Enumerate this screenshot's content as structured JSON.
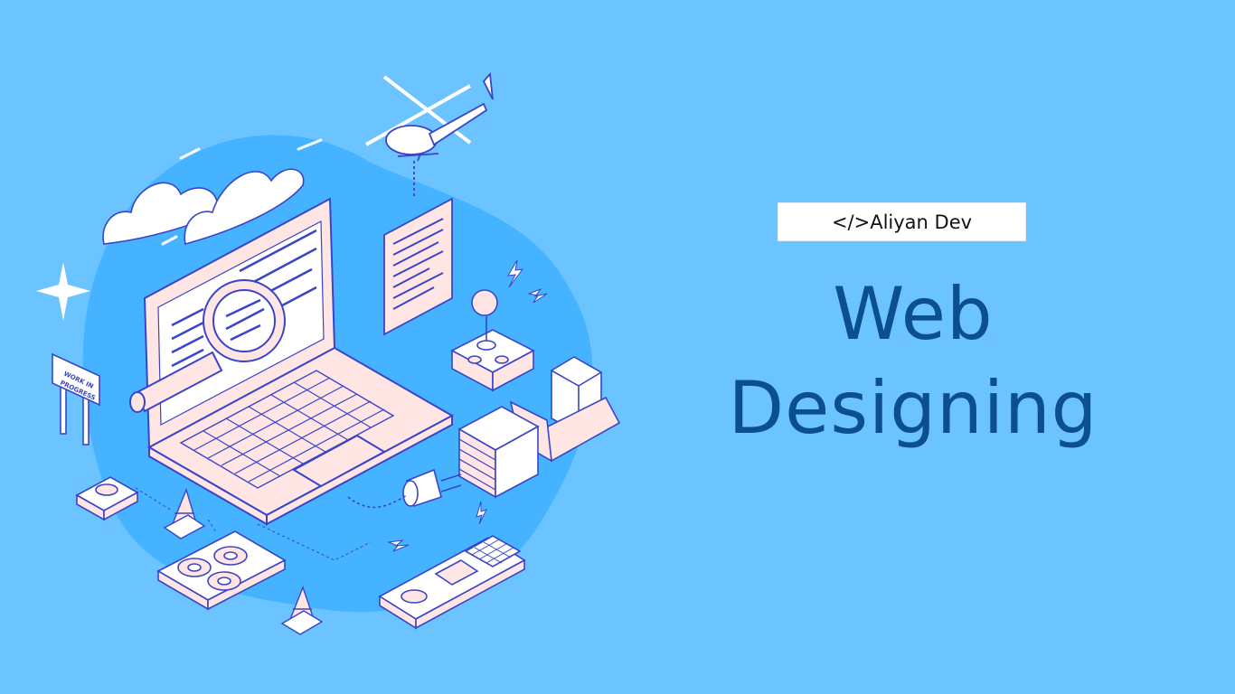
{
  "brand": {
    "label": "</>Aliyan Dev"
  },
  "headline": {
    "line1": "Web",
    "line2": "Designing"
  },
  "sign": {
    "line1": "WORK IN",
    "line2": "PROGRESS"
  },
  "colors": {
    "background": "#6bc4ff",
    "blob": "#45b3ff",
    "outline": "#3a44c8",
    "surface": "#ffe6e4",
    "white": "#ffffff",
    "headline": "#0b4f91"
  },
  "icons": [
    "sparkle-icon",
    "cloud-icon",
    "helicopter-icon",
    "laptop-icon",
    "magnifier-icon",
    "document-icon",
    "joystick-icon",
    "server-icon",
    "bulldozer-icon",
    "plug-icon",
    "cone-icon",
    "gears-icon",
    "control-panel-icon",
    "button-icon",
    "lightning-icon"
  ]
}
